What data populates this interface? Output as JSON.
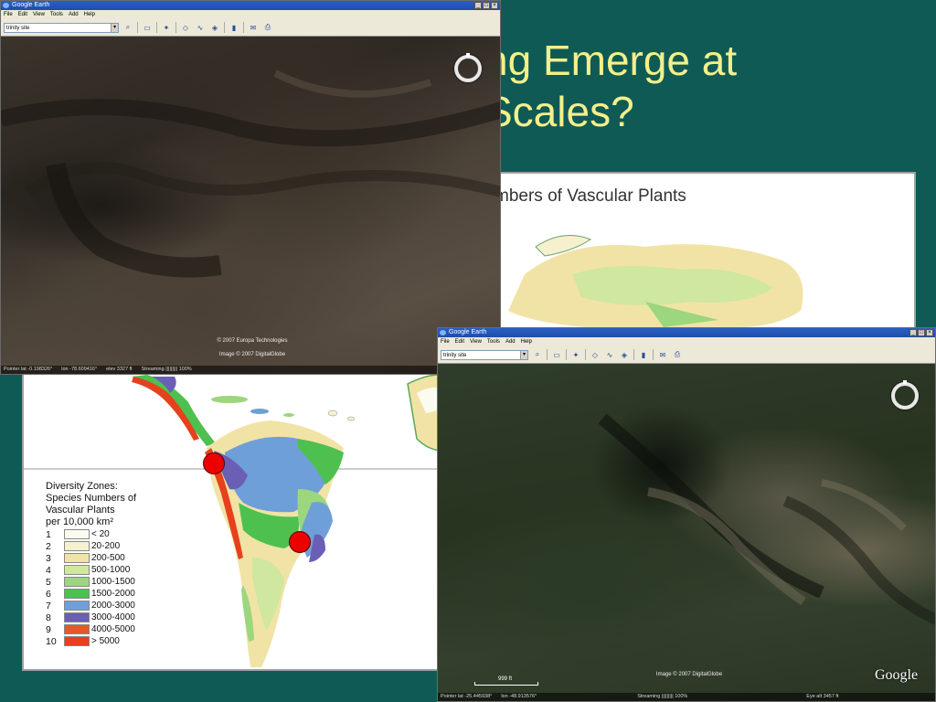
{
  "slide": {
    "title_line1": "ng Emerge at",
    "title_line2": "Scales?"
  },
  "map": {
    "title": "mbers of Vascular Plants",
    "legend_title_1": "Diversity Zones:",
    "legend_title_2": "Species Numbers of",
    "legend_title_3": "Vascular Plants",
    "legend_title_4": "per 10,000 km²",
    "legend": [
      {
        "num": "1",
        "label": "< 20",
        "color": "#fbfbf0"
      },
      {
        "num": "2",
        "label": "20-200",
        "color": "#f5f1cf"
      },
      {
        "num": "3",
        "label": "200-500",
        "color": "#f1e3a6"
      },
      {
        "num": "4",
        "label": "500-1000",
        "color": "#cfe79f"
      },
      {
        "num": "5",
        "label": "1000-1500",
        "color": "#9cd67e"
      },
      {
        "num": "6",
        "label": "1500-2000",
        "color": "#4ec04f"
      },
      {
        "num": "7",
        "label": "2000-3000",
        "color": "#6e9fd9"
      },
      {
        "num": "8",
        "label": "3000-4000",
        "color": "#6a5fb5"
      },
      {
        "num": "9",
        "label": "4000-5000",
        "color": "#e05a2a"
      },
      {
        "num": "10",
        "label": "> 5000",
        "color": "#e6401c"
      }
    ]
  },
  "ge_top": {
    "title": "Google Earth",
    "menu": [
      "File",
      "Edit",
      "View",
      "Tools",
      "Add",
      "Help"
    ],
    "search_value": "trinity site",
    "copyright_1": "© 2007 Europa Technologies",
    "copyright_2": "Image © 2007 DigitalGlobe",
    "status_pointer": "Pointer   lat  -0.198326°",
    "status_lon": "lon  -78.609416°",
    "status_elev": "elev  3327 ft",
    "status_stream": "Streaming ||||||||| 100%"
  },
  "ge_bottom": {
    "title": "Google Earth",
    "menu": [
      "File",
      "Edit",
      "View",
      "Tools",
      "Add",
      "Help"
    ],
    "search_value": "trinity site",
    "copyright_1": "Image © 2007 DigitalGlobe",
    "scale_label": "999 ft",
    "logo": "Google",
    "status_pointer": "Pointer   lat  -25.445938°",
    "status_lon": "lon  -48.913576°",
    "status_stream": "Streaming ||||||||| 100%",
    "status_eye": "Eye alt    3457 ft"
  }
}
